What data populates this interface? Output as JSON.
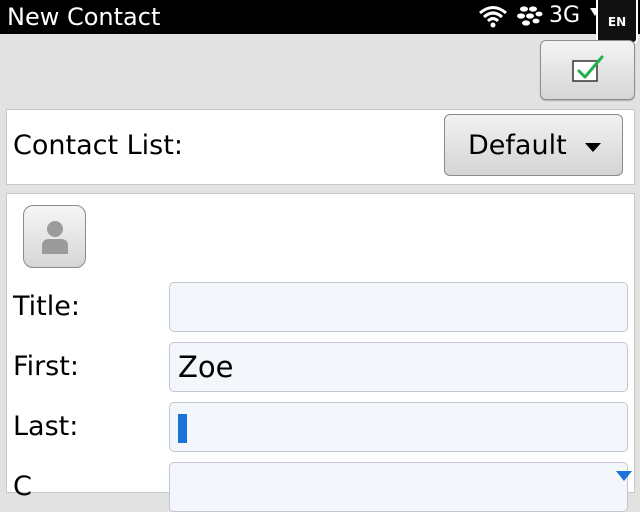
{
  "status_bar": {
    "title": "New Contact",
    "network": "3G",
    "language": "EN",
    "icons": [
      "wifi-icon",
      "bbm-icon",
      "signal-icon"
    ]
  },
  "toolbar": {
    "save_icon": "checkbox-check-icon"
  },
  "contact_list": {
    "label": "Contact List:",
    "selected": "Default",
    "arrow_icon": "triangle-down-icon"
  },
  "form": {
    "avatar_icon": "person-icon",
    "fields": [
      {
        "label": "Title:",
        "value": ""
      },
      {
        "label": "First:",
        "value": "Zoe"
      },
      {
        "label": "Last:",
        "value": ""
      },
      {
        "label": "C",
        "value": ""
      }
    ]
  },
  "colors": {
    "accent": "#1a73d9",
    "check": "#22b14c",
    "status_bar": "#000000",
    "background": "#e2e2e2"
  }
}
